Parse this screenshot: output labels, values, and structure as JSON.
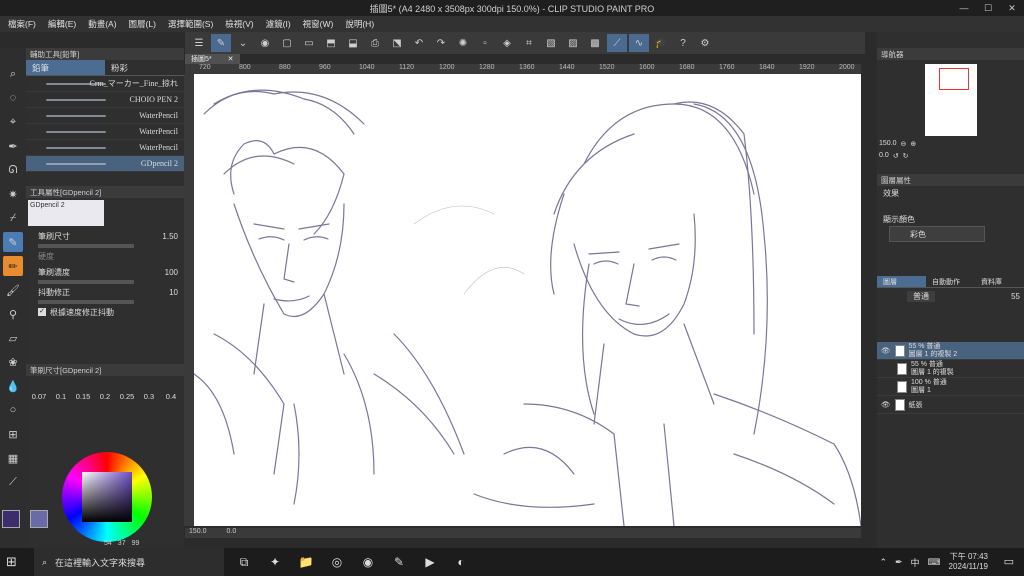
{
  "window": {
    "title": "插圖5* (A4 2480 x 3508px 300dpi 150.0%) - CLIP STUDIO PAINT PRO",
    "minimize": "—",
    "maximize": "☐",
    "close": "✕"
  },
  "menu": [
    "檔案(F)",
    "編輯(E)",
    "動畫(A)",
    "圖層(L)",
    "選擇範圍(S)",
    "檢視(V)",
    "濾鏡(I)",
    "視窗(W)",
    "說明(H)"
  ],
  "sub_tool": {
    "panel_title": "輔助工具[鉛筆]",
    "tabs": [
      "鉛筆",
      "粉彩"
    ],
    "brushes": [
      "Crm_マーカー_Fine_掠れ",
      "CHOIO PEN 2",
      "WaterPencil",
      "WaterPencil",
      "WaterPencil",
      "GDpencil 2"
    ],
    "selected_brush": "GDpencil 2"
  },
  "tool_property": {
    "panel_title": "工具屬性[GDpencil 2]",
    "preview_label": "GDpencil 2",
    "brush_size_label": "筆刷尺寸",
    "brush_size_value": "1.50",
    "hardness_label": "硬度",
    "density_label": "筆刷濃度",
    "density_value": "100",
    "stabilization_label": "抖動修正",
    "stabilization_value": "10",
    "speed_checkbox": "根據速度修正抖動"
  },
  "brush_size_panel": {
    "panel_title": "筆刷尺寸[GDpencil 2]",
    "sizes": [
      "0.07",
      "0.1",
      "0.15",
      "0.2",
      "0.25",
      "0.3",
      "0.4"
    ]
  },
  "color": {
    "main": "#3d2d6e",
    "sub": "#6b6aa8",
    "values": [
      "54",
      "37",
      "99"
    ]
  },
  "document_tab": "插圖5*",
  "ruler_top": [
    "720",
    "800",
    "880",
    "960",
    "1040",
    "1120",
    "1200",
    "1280",
    "1360",
    "1440",
    "1520",
    "1600",
    "1680",
    "1760",
    "1840",
    "1920",
    "2000",
    "2080",
    "2160",
    "2240",
    "2320"
  ],
  "ruler_left": [
    "400",
    "480",
    "560",
    "640",
    "720",
    "800",
    "880",
    "960",
    "1040",
    "1120"
  ],
  "status": {
    "zoom": "150.0",
    "angle": "0.0"
  },
  "navigator": {
    "title": "導航器",
    "zoom": "150.0",
    "angle": "0.0"
  },
  "layer_property": {
    "title": "圖層屬性",
    "effect_label": "效果",
    "display_color_label": "顯示顏色",
    "display_color_value": "彩色"
  },
  "layers": {
    "tabs": [
      "圖層",
      "自動動作",
      "資料庫"
    ],
    "blend_mode": "普通",
    "opacity": "55",
    "items": [
      {
        "name": "55 % 普通",
        "sub": "圖層 1 的複製 2",
        "selected": true
      },
      {
        "name": "55 % 普通",
        "sub": "圖層 1 的複製",
        "selected": false
      },
      {
        "name": "100 % 普通",
        "sub": "圖層 1",
        "selected": false
      },
      {
        "name": "紙張",
        "sub": "",
        "selected": false
      }
    ]
  },
  "taskbar": {
    "search_placeholder": "在這裡輸入文字來搜尋",
    "time": "下午 07:43",
    "date": "2024/11/19",
    "ime": "中"
  },
  "colors": {
    "accent": "#4b7db5",
    "selected_row": "#49627e",
    "sketch": "#6b6890"
  }
}
